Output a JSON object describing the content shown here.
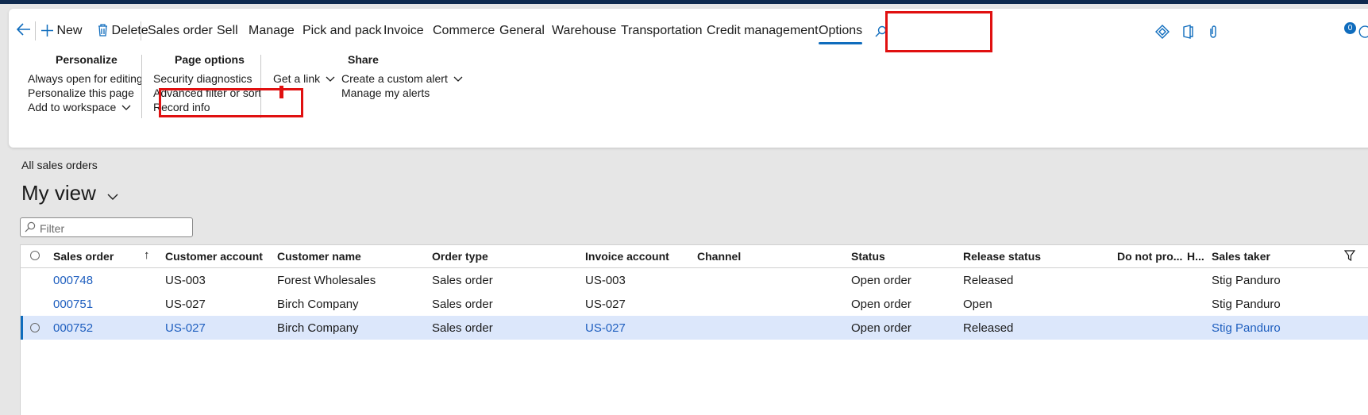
{
  "toolbar": {
    "new_label": "New",
    "delete_label": "Delete",
    "tabs": [
      "Sales order",
      "Sell",
      "Manage",
      "Pick and pack",
      "Invoice",
      "Commerce",
      "General",
      "Warehouse",
      "Transportation",
      "Credit management",
      "Options"
    ],
    "active_tab": "Options",
    "notification_count": "0"
  },
  "ribbon": {
    "personalize": {
      "title": "Personalize",
      "items": [
        "Always open for editing",
        "Personalize this page",
        "Add to workspace"
      ]
    },
    "page_options": {
      "title": "Page options",
      "items": [
        "Security diagnostics",
        "Advanced filter or sort",
        "Record info"
      ]
    },
    "get_link": "Get a link",
    "share": {
      "title": "Share",
      "items": [
        "Create a custom alert",
        "Manage my alerts"
      ]
    }
  },
  "page": {
    "breadcrumb": "All sales orders",
    "view_title": "My view",
    "filter_placeholder": "Filter"
  },
  "grid": {
    "columns": [
      "Sales order",
      "Customer account",
      "Customer name",
      "Order type",
      "Invoice account",
      "Channel",
      "Status",
      "Release status",
      "Do not pro...",
      "H...",
      "Sales taker"
    ],
    "rows": [
      {
        "sales_order": "000748",
        "customer_account": "US-003",
        "customer_name": "Forest Wholesales",
        "order_type": "Sales order",
        "invoice_account": "US-003",
        "channel": "",
        "status": "Open order",
        "release_status": "Released",
        "sales_taker": "Stig Panduro"
      },
      {
        "sales_order": "000751",
        "customer_account": "US-027",
        "customer_name": "Birch Company",
        "order_type": "Sales order",
        "invoice_account": "US-027",
        "channel": "",
        "status": "Open order",
        "release_status": "Open",
        "sales_taker": "Stig Panduro"
      },
      {
        "sales_order": "000752",
        "customer_account": "US-027",
        "customer_name": "Birch Company",
        "order_type": "Sales order",
        "invoice_account": "US-027",
        "channel": "",
        "status": "Open order",
        "release_status": "Released",
        "sales_taker": "Stig Panduro"
      }
    ],
    "selected_row": 2
  },
  "colors": {
    "accent": "#0f6cbd",
    "link": "#1f5fbf",
    "highlight_box": "#e01010",
    "selected_row": "#dce7fb"
  }
}
